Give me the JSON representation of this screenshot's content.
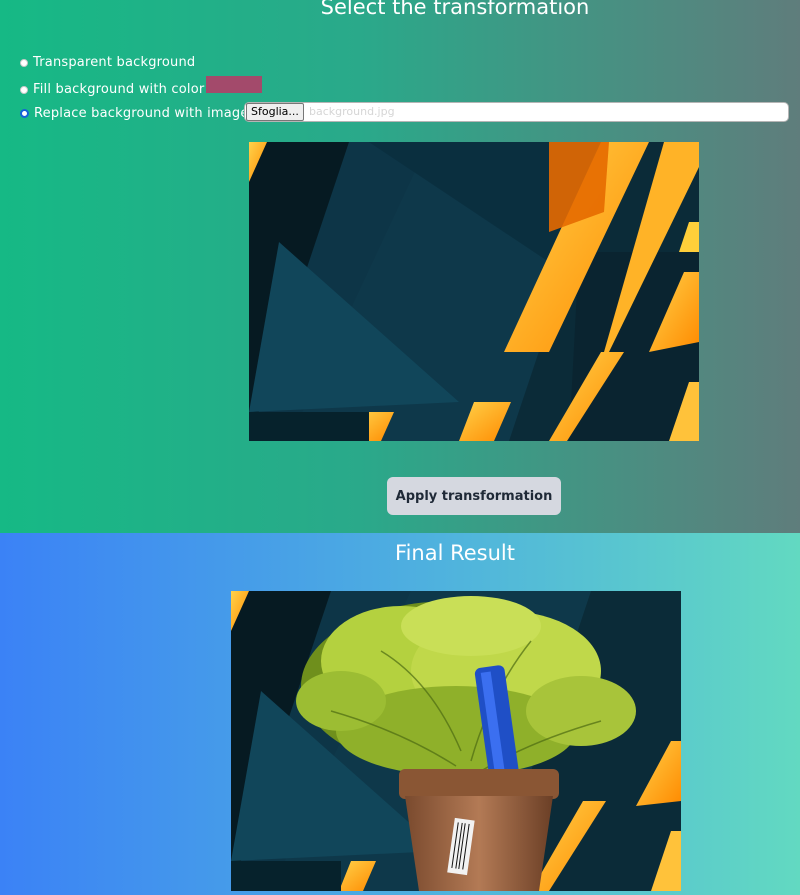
{
  "transform": {
    "title": "Select the transformation",
    "options": [
      {
        "label": "Transparent background",
        "checked": false
      },
      {
        "label": "Fill background with color",
        "checked": false,
        "color": "#a34a6b"
      },
      {
        "label": "Replace background with image",
        "checked": true
      }
    ],
    "file_button": "Sfoglia...",
    "file_name": "background.jpg",
    "apply_label": "Apply transformation"
  },
  "result": {
    "title": "Final Result"
  }
}
